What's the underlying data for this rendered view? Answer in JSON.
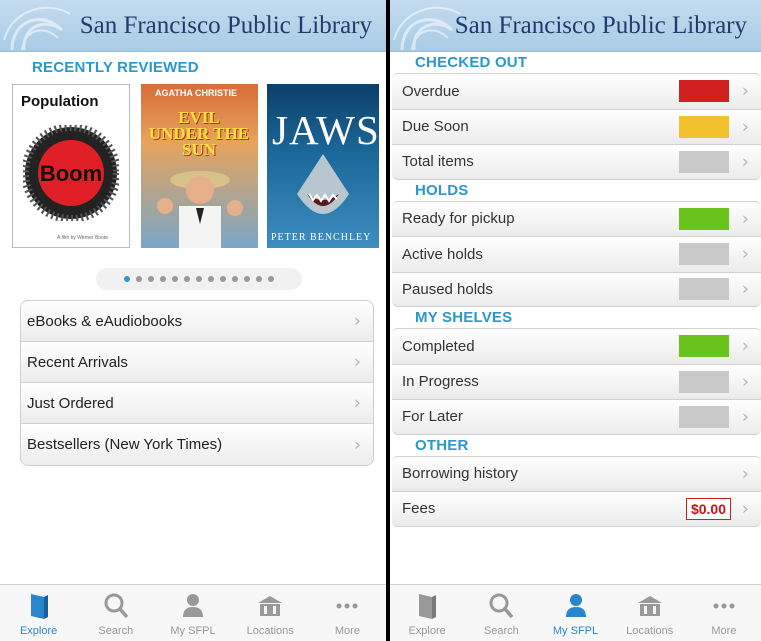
{
  "header_title": "San Francisco Public Library",
  "left": {
    "section_title": "RECENTLY REVIEWED",
    "covers": {
      "population": {
        "title": "Population",
        "boom": "Boom",
        "byline": "A film by Werner Boote"
      },
      "evil": {
        "author": "AGATHA CHRISTIE",
        "title": "EVIL UNDER THE SUN"
      },
      "jaws": {
        "title": "JAWS",
        "author": "PETER BENCHLEY"
      }
    },
    "carousel": {
      "count": 13,
      "active_index": 0
    },
    "menu": [
      {
        "label": "eBooks & eAudiobooks"
      },
      {
        "label": "Recent Arrivals"
      },
      {
        "label": "Just Ordered"
      },
      {
        "label": "Bestsellers (New York Times)"
      }
    ]
  },
  "right": {
    "sections": {
      "checked_out": {
        "title": "CHECKED OUT",
        "rows": [
          {
            "label": "Overdue",
            "color": "#d01f1f"
          },
          {
            "label": "Due Soon",
            "color": "#f2c12e"
          },
          {
            "label": "Total items",
            "color": "#c9c9c9"
          }
        ]
      },
      "holds": {
        "title": "HOLDS",
        "rows": [
          {
            "label": "Ready for pickup",
            "color": "#69c31c"
          },
          {
            "label": "Active holds",
            "color": "#c9c9c9"
          },
          {
            "label": "Paused holds",
            "color": "#c9c9c9"
          }
        ]
      },
      "my_shelves": {
        "title": "MY SHELVES",
        "rows": [
          {
            "label": "Completed",
            "color": "#69c31c"
          },
          {
            "label": "In Progress",
            "color": "#c9c9c9"
          },
          {
            "label": "For Later",
            "color": "#c9c9c9"
          }
        ]
      },
      "other": {
        "title": "OTHER",
        "rows": [
          {
            "label": "Borrowing history"
          },
          {
            "label": "Fees",
            "value": "$0.00"
          }
        ]
      }
    }
  },
  "tabs": {
    "explore": "Explore",
    "search": "Search",
    "my_sfpl": "My SFPL",
    "locations": "Locations",
    "more": "More"
  },
  "colors": {
    "accent": "#2a97cf",
    "tab_active": "#2a86cc",
    "header_title": "#1f3c6e"
  }
}
